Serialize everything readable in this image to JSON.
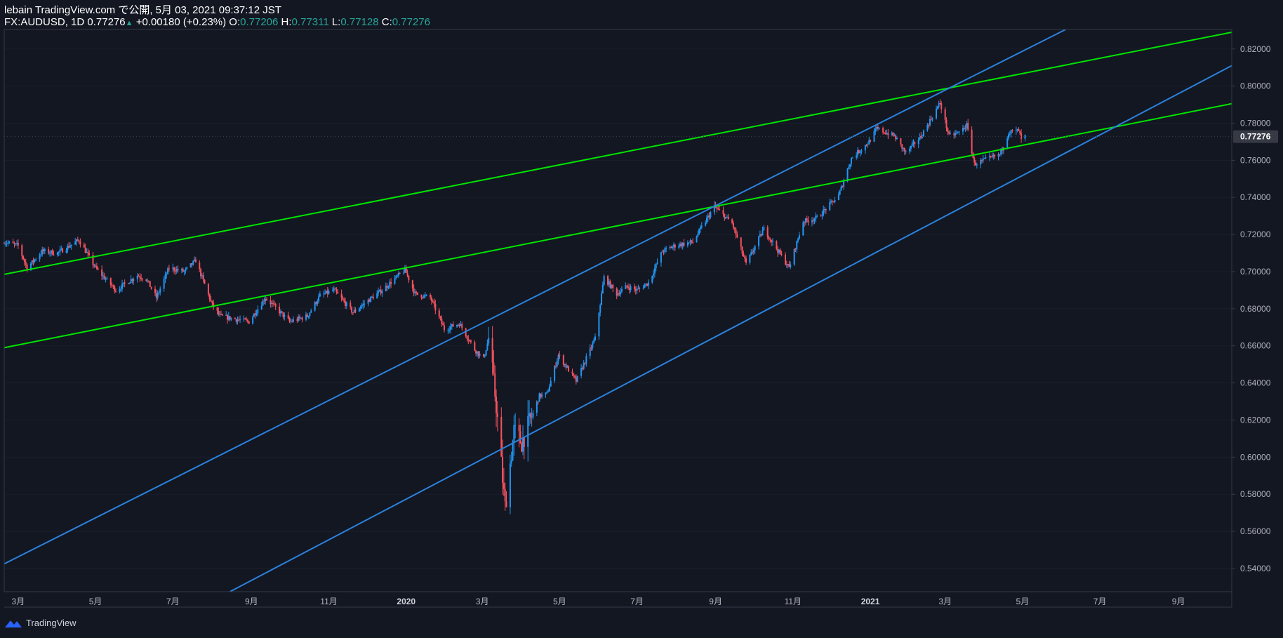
{
  "header": {
    "publish_line": "lebain TradingView.com で公開, 5月 03, 2021 09:37:12 JST",
    "symbol": "FX:AUDUSD",
    "interval": "1D",
    "last": "0.77276",
    "change_arrow": "▲",
    "change": "+0.00180 (+0.23%)",
    "o_label": "O:",
    "o_value": "0.77206",
    "h_label": "H:",
    "h_value": "0.77311",
    "l_label": "L:",
    "l_value": "0.77128",
    "c_label": "C:",
    "c_value": "0.77276"
  },
  "footer": {
    "brand": "TradingView"
  },
  "colors": {
    "background": "#131722",
    "up_candle": "#2196f3",
    "down_candle": "#f7525f",
    "green_line": "#00e600",
    "blue_line": "#2b82dd",
    "price_label_bg": "#363a45",
    "axis_text": "#b2b5be",
    "axis_line": "#363a45"
  },
  "chart_data": {
    "type": "candlestick",
    "y_axis": {
      "range": [
        0.5275,
        0.8305
      ],
      "ticks": [
        "0.54000",
        "0.56000",
        "0.58000",
        "0.60000",
        "0.62000",
        "0.64000",
        "0.66000",
        "0.68000",
        "0.70000",
        "0.72000",
        "0.74000",
        "0.76000",
        "0.78000",
        "0.80000",
        "0.82000"
      ],
      "current_price": "0.77276"
    },
    "x_axis": {
      "labels": [
        "3月",
        "5月",
        "7月",
        "9月",
        "11月",
        "2020",
        "3月",
        "5月",
        "7月",
        "9月",
        "11月",
        "2021",
        "3月",
        "5月",
        "7月",
        "9月"
      ],
      "label_dates": [
        "2019-03-01",
        "2019-05-01",
        "2019-07-01",
        "2019-09-01",
        "2019-11-01",
        "2020-01-01",
        "2020-03-01",
        "2020-05-01",
        "2020-07-01",
        "2020-09-01",
        "2020-11-01",
        "2021-01-01",
        "2021-03-01",
        "2021-05-01",
        "2021-07-01",
        "2021-09-01"
      ],
      "range": [
        "2019-02-18",
        "2021-10-13"
      ]
    },
    "price_path": [
      [
        "2019-02-18",
        0.716
      ],
      [
        "2019-03-01",
        0.714
      ],
      [
        "2019-03-08",
        0.702
      ],
      [
        "2019-03-20",
        0.711
      ],
      [
        "2019-04-01",
        0.71
      ],
      [
        "2019-04-18",
        0.717
      ],
      [
        "2019-05-01",
        0.702
      ],
      [
        "2019-05-17",
        0.69
      ],
      [
        "2019-06-03",
        0.698
      ],
      [
        "2019-06-10",
        0.696
      ],
      [
        "2019-06-18",
        0.686
      ],
      [
        "2019-06-28",
        0.702
      ],
      [
        "2019-07-10",
        0.7
      ],
      [
        "2019-07-19",
        0.706
      ],
      [
        "2019-08-01",
        0.682
      ],
      [
        "2019-08-07",
        0.676
      ],
      [
        "2019-08-30",
        0.673
      ],
      [
        "2019-09-12",
        0.686
      ],
      [
        "2019-10-01",
        0.673
      ],
      [
        "2019-10-15",
        0.676
      ],
      [
        "2019-10-25",
        0.687
      ],
      [
        "2019-11-05",
        0.69
      ],
      [
        "2019-11-20",
        0.678
      ],
      [
        "2019-12-03",
        0.685
      ],
      [
        "2019-12-13",
        0.69
      ],
      [
        "2019-12-31",
        0.701
      ],
      [
        "2020-01-08",
        0.688
      ],
      [
        "2020-01-20",
        0.686
      ],
      [
        "2020-01-31",
        0.669
      ],
      [
        "2020-02-12",
        0.672
      ],
      [
        "2020-02-24",
        0.658
      ],
      [
        "2020-03-02",
        0.653
      ],
      [
        "2020-03-06",
        0.664
      ],
      [
        "2020-03-12",
        0.628
      ],
      [
        "2020-03-18",
        0.58
      ],
      [
        "2020-03-19",
        0.573
      ],
      [
        "2020-03-26",
        0.614
      ],
      [
        "2020-04-01",
        0.608
      ],
      [
        "2020-04-08",
        0.62
      ],
      [
        "2020-04-15",
        0.633
      ],
      [
        "2020-04-21",
        0.634
      ],
      [
        "2020-04-30",
        0.655
      ],
      [
        "2020-05-14",
        0.641
      ],
      [
        "2020-05-29",
        0.664
      ],
      [
        "2020-06-05",
        0.697
      ],
      [
        "2020-06-15",
        0.688
      ],
      [
        "2020-06-23",
        0.692
      ],
      [
        "2020-07-01",
        0.69
      ],
      [
        "2020-07-10",
        0.694
      ],
      [
        "2020-07-21",
        0.711
      ],
      [
        "2020-07-31",
        0.714
      ],
      [
        "2020-08-14",
        0.716
      ],
      [
        "2020-08-31",
        0.735
      ],
      [
        "2020-09-14",
        0.726
      ],
      [
        "2020-09-25",
        0.704
      ],
      [
        "2020-10-09",
        0.723
      ],
      [
        "2020-10-29",
        0.702
      ],
      [
        "2020-11-09",
        0.727
      ],
      [
        "2020-11-20",
        0.729
      ],
      [
        "2020-12-07",
        0.741
      ],
      [
        "2020-12-17",
        0.761
      ],
      [
        "2020-12-31",
        0.77
      ],
      [
        "2021-01-06",
        0.777
      ],
      [
        "2021-01-20",
        0.773
      ],
      [
        "2021-01-29",
        0.764
      ],
      [
        "2021-02-10",
        0.773
      ],
      [
        "2021-02-25",
        0.791
      ],
      [
        "2021-03-04",
        0.773
      ],
      [
        "2021-03-12",
        0.775
      ],
      [
        "2021-03-18",
        0.779
      ],
      [
        "2021-03-24",
        0.758
      ],
      [
        "2021-04-01",
        0.76
      ],
      [
        "2021-04-13",
        0.763
      ],
      [
        "2021-04-20",
        0.775
      ],
      [
        "2021-04-28",
        0.776
      ],
      [
        "2021-04-30",
        0.771
      ],
      [
        "2021-05-03",
        0.7728
      ]
    ],
    "trendlines": [
      {
        "color": "green",
        "points": [
          [
            "2019-02-18",
            0.6985
          ],
          [
            "2021-10-13",
            0.829
          ]
        ]
      },
      {
        "color": "green",
        "points": [
          [
            "2019-02-18",
            0.659
          ],
          [
            "2021-10-13",
            0.7905
          ]
        ]
      },
      {
        "color": "blue",
        "points": [
          [
            "2019-02-18",
            0.5425
          ],
          [
            "2021-06-04",
            0.8305
          ]
        ]
      },
      {
        "color": "blue",
        "points": [
          [
            "2019-08-15",
            0.5275
          ],
          [
            "2021-10-13",
            0.811
          ]
        ]
      }
    ]
  }
}
